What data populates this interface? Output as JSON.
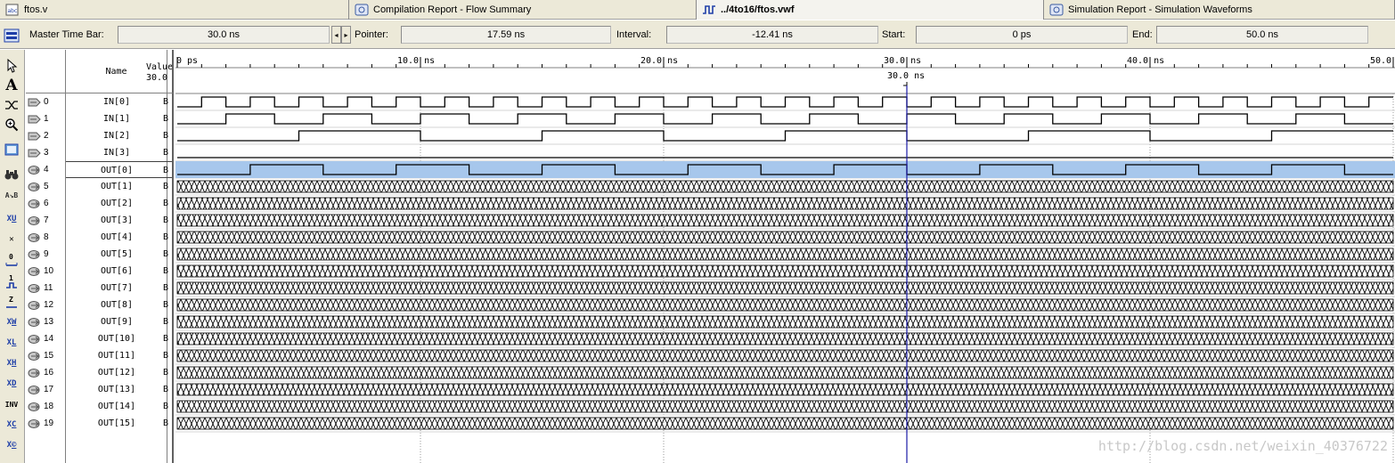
{
  "tabs": [
    {
      "label": "ftos.v",
      "icon": "verilog-file-icon",
      "active": false
    },
    {
      "label": "Compilation Report - Flow Summary",
      "icon": "report-icon",
      "active": false
    },
    {
      "label": "../4to16/ftos.vwf",
      "icon": "waveform-file-icon",
      "active": true
    },
    {
      "label": "Simulation Report - Simulation Waveforms",
      "icon": "report-icon",
      "active": false
    }
  ],
  "timebar": {
    "master_label": "Master Time Bar:",
    "master_value": "30.0 ns",
    "pointer_label": "Pointer:",
    "pointer_value": "17.59 ns",
    "interval_label": "Interval:",
    "interval_value": "-12.41 ns",
    "start_label": "Start:",
    "start_value": "0 ps",
    "end_label": "End:",
    "end_value": "50.0 ns"
  },
  "toolbar_icons": [
    "waveform-editor-icon",
    "pointer-icon",
    "text-icon",
    "node-finder-icon",
    "zoom-icon",
    "full-screen-icon",
    "find-icon",
    "replace-icon",
    "uninitialized-icon",
    "forcing-unknown-icon",
    "forcing-low-icon",
    "forcing-high-icon",
    "high-impedance-icon",
    "weak-unknown-icon",
    "weak-low-icon",
    "weak-high-icon",
    "dont-care-icon",
    "invert-icon",
    "count-value-icon",
    "clock-value-icon"
  ],
  "columns": {
    "name": "Name",
    "value": "Value at",
    "value_time": "30.0 ns"
  },
  "ruler": {
    "ticks": [
      "0 ps",
      "10.0 ns",
      "20.0 ns",
      "30.0 ns",
      "40.0 ns",
      "50.0 ns"
    ],
    "cursor_label": "30.0 ns",
    "cursor_time_ns": 30.0,
    "range_ns": [
      0,
      50
    ]
  },
  "signals": [
    {
      "index": "0",
      "name": "IN[0]",
      "value": "B",
      "type": "input",
      "period_ns": 2.0
    },
    {
      "index": "1",
      "name": "IN[1]",
      "value": "B",
      "type": "input",
      "period_ns": 4.0
    },
    {
      "index": "2",
      "name": "IN[2]",
      "value": "B",
      "type": "input",
      "period_ns": 10.0
    },
    {
      "index": "3",
      "name": "IN[3]",
      "value": "B",
      "type": "input",
      "period_ns": 0
    },
    {
      "index": "4",
      "name": "OUT[0]",
      "value": "B",
      "type": "output",
      "period_ns": 6.0,
      "selected": true
    },
    {
      "index": "5",
      "name": "OUT[1]",
      "value": "B",
      "type": "output",
      "state": "unknown"
    },
    {
      "index": "6",
      "name": "OUT[2]",
      "value": "B",
      "type": "output",
      "state": "unknown"
    },
    {
      "index": "7",
      "name": "OUT[3]",
      "value": "B",
      "type": "output",
      "state": "unknown"
    },
    {
      "index": "8",
      "name": "OUT[4]",
      "value": "B",
      "type": "output",
      "state": "unknown"
    },
    {
      "index": "9",
      "name": "OUT[5]",
      "value": "B",
      "type": "output",
      "state": "unknown"
    },
    {
      "index": "10",
      "name": "OUT[6]",
      "value": "B",
      "type": "output",
      "state": "unknown"
    },
    {
      "index": "11",
      "name": "OUT[7]",
      "value": "B",
      "type": "output",
      "state": "unknown"
    },
    {
      "index": "12",
      "name": "OUT[8]",
      "value": "B",
      "type": "output",
      "state": "unknown"
    },
    {
      "index": "13",
      "name": "OUT[9]",
      "value": "B",
      "type": "output",
      "state": "unknown"
    },
    {
      "index": "14",
      "name": "OUT[10]",
      "value": "B",
      "type": "output",
      "state": "unknown"
    },
    {
      "index": "15",
      "name": "OUT[11]",
      "value": "B",
      "type": "output",
      "state": "unknown"
    },
    {
      "index": "16",
      "name": "OUT[12]",
      "value": "B",
      "type": "output",
      "state": "unknown"
    },
    {
      "index": "17",
      "name": "OUT[13]",
      "value": "B",
      "type": "output",
      "state": "unknown"
    },
    {
      "index": "18",
      "name": "OUT[14]",
      "value": "B",
      "type": "output",
      "state": "unknown"
    },
    {
      "index": "19",
      "name": "OUT[15]",
      "value": "B",
      "type": "output",
      "state": "unknown"
    }
  ],
  "watermark": "http://blog.csdn.net/weixin_40376722",
  "colors": {
    "cursor": "#1a1aa6",
    "selected_row": "#a7c7ec",
    "hatch": "#000000"
  }
}
